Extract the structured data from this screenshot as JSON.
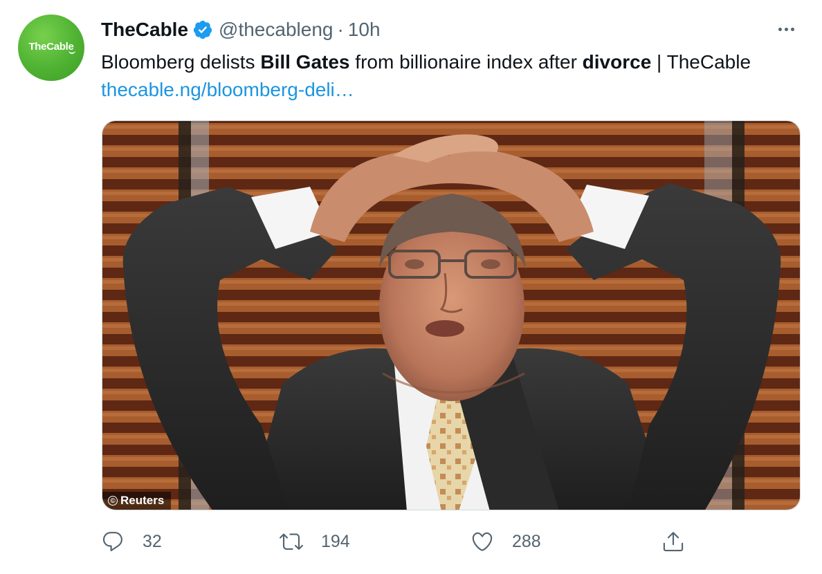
{
  "tweet": {
    "author": {
      "display_name": "TheCable",
      "handle": "@thecableng",
      "verified": true,
      "avatar_text": "TheCable",
      "avatar_color": "#4fb232"
    },
    "separator": "·",
    "time": "10h",
    "more_icon": "more-horizontal-icon",
    "text": {
      "p1": "Bloomberg delists ",
      "b1": "Bill Gates",
      "p2": " from billionaire index after ",
      "b2": "divorce",
      "p3": " | TheCable ",
      "link": "thecable.ng/bloomberg-deli…"
    },
    "media": {
      "credit": "Reuters",
      "credit_symbol": "©"
    },
    "actions": {
      "reply": {
        "icon": "reply-icon",
        "count": "32"
      },
      "retweet": {
        "icon": "retweet-icon",
        "count": "194"
      },
      "like": {
        "icon": "heart-icon",
        "count": "288"
      },
      "share": {
        "icon": "share-icon"
      }
    },
    "colors": {
      "link": "#1b95e0",
      "verified": "#1d9bf0",
      "secondary_text": "#536471"
    }
  }
}
